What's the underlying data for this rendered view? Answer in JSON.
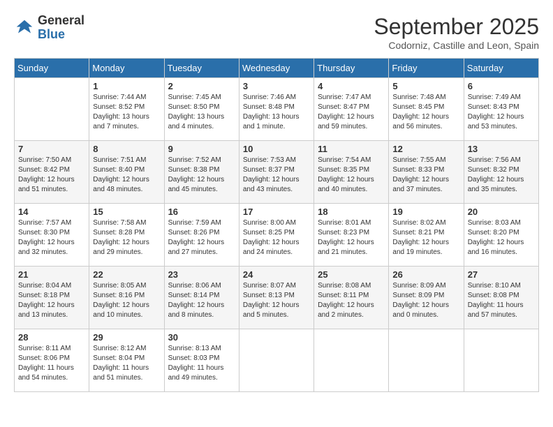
{
  "header": {
    "logo_line1": "General",
    "logo_line2": "Blue",
    "month": "September 2025",
    "location": "Codorniz, Castille and Leon, Spain"
  },
  "weekdays": [
    "Sunday",
    "Monday",
    "Tuesday",
    "Wednesday",
    "Thursday",
    "Friday",
    "Saturday"
  ],
  "weeks": [
    [
      {
        "day": "",
        "sunrise": "",
        "sunset": "",
        "daylight": ""
      },
      {
        "day": "1",
        "sunrise": "Sunrise: 7:44 AM",
        "sunset": "Sunset: 8:52 PM",
        "daylight": "Daylight: 13 hours and 7 minutes."
      },
      {
        "day": "2",
        "sunrise": "Sunrise: 7:45 AM",
        "sunset": "Sunset: 8:50 PM",
        "daylight": "Daylight: 13 hours and 4 minutes."
      },
      {
        "day": "3",
        "sunrise": "Sunrise: 7:46 AM",
        "sunset": "Sunset: 8:48 PM",
        "daylight": "Daylight: 13 hours and 1 minute."
      },
      {
        "day": "4",
        "sunrise": "Sunrise: 7:47 AM",
        "sunset": "Sunset: 8:47 PM",
        "daylight": "Daylight: 12 hours and 59 minutes."
      },
      {
        "day": "5",
        "sunrise": "Sunrise: 7:48 AM",
        "sunset": "Sunset: 8:45 PM",
        "daylight": "Daylight: 12 hours and 56 minutes."
      },
      {
        "day": "6",
        "sunrise": "Sunrise: 7:49 AM",
        "sunset": "Sunset: 8:43 PM",
        "daylight": "Daylight: 12 hours and 53 minutes."
      }
    ],
    [
      {
        "day": "7",
        "sunrise": "Sunrise: 7:50 AM",
        "sunset": "Sunset: 8:42 PM",
        "daylight": "Daylight: 12 hours and 51 minutes."
      },
      {
        "day": "8",
        "sunrise": "Sunrise: 7:51 AM",
        "sunset": "Sunset: 8:40 PM",
        "daylight": "Daylight: 12 hours and 48 minutes."
      },
      {
        "day": "9",
        "sunrise": "Sunrise: 7:52 AM",
        "sunset": "Sunset: 8:38 PM",
        "daylight": "Daylight: 12 hours and 45 minutes."
      },
      {
        "day": "10",
        "sunrise": "Sunrise: 7:53 AM",
        "sunset": "Sunset: 8:37 PM",
        "daylight": "Daylight: 12 hours and 43 minutes."
      },
      {
        "day": "11",
        "sunrise": "Sunrise: 7:54 AM",
        "sunset": "Sunset: 8:35 PM",
        "daylight": "Daylight: 12 hours and 40 minutes."
      },
      {
        "day": "12",
        "sunrise": "Sunrise: 7:55 AM",
        "sunset": "Sunset: 8:33 PM",
        "daylight": "Daylight: 12 hours and 37 minutes."
      },
      {
        "day": "13",
        "sunrise": "Sunrise: 7:56 AM",
        "sunset": "Sunset: 8:32 PM",
        "daylight": "Daylight: 12 hours and 35 minutes."
      }
    ],
    [
      {
        "day": "14",
        "sunrise": "Sunrise: 7:57 AM",
        "sunset": "Sunset: 8:30 PM",
        "daylight": "Daylight: 12 hours and 32 minutes."
      },
      {
        "day": "15",
        "sunrise": "Sunrise: 7:58 AM",
        "sunset": "Sunset: 8:28 PM",
        "daylight": "Daylight: 12 hours and 29 minutes."
      },
      {
        "day": "16",
        "sunrise": "Sunrise: 7:59 AM",
        "sunset": "Sunset: 8:26 PM",
        "daylight": "Daylight: 12 hours and 27 minutes."
      },
      {
        "day": "17",
        "sunrise": "Sunrise: 8:00 AM",
        "sunset": "Sunset: 8:25 PM",
        "daylight": "Daylight: 12 hours and 24 minutes."
      },
      {
        "day": "18",
        "sunrise": "Sunrise: 8:01 AM",
        "sunset": "Sunset: 8:23 PM",
        "daylight": "Daylight: 12 hours and 21 minutes."
      },
      {
        "day": "19",
        "sunrise": "Sunrise: 8:02 AM",
        "sunset": "Sunset: 8:21 PM",
        "daylight": "Daylight: 12 hours and 19 minutes."
      },
      {
        "day": "20",
        "sunrise": "Sunrise: 8:03 AM",
        "sunset": "Sunset: 8:20 PM",
        "daylight": "Daylight: 12 hours and 16 minutes."
      }
    ],
    [
      {
        "day": "21",
        "sunrise": "Sunrise: 8:04 AM",
        "sunset": "Sunset: 8:18 PM",
        "daylight": "Daylight: 12 hours and 13 minutes."
      },
      {
        "day": "22",
        "sunrise": "Sunrise: 8:05 AM",
        "sunset": "Sunset: 8:16 PM",
        "daylight": "Daylight: 12 hours and 10 minutes."
      },
      {
        "day": "23",
        "sunrise": "Sunrise: 8:06 AM",
        "sunset": "Sunset: 8:14 PM",
        "daylight": "Daylight: 12 hours and 8 minutes."
      },
      {
        "day": "24",
        "sunrise": "Sunrise: 8:07 AM",
        "sunset": "Sunset: 8:13 PM",
        "daylight": "Daylight: 12 hours and 5 minutes."
      },
      {
        "day": "25",
        "sunrise": "Sunrise: 8:08 AM",
        "sunset": "Sunset: 8:11 PM",
        "daylight": "Daylight: 12 hours and 2 minutes."
      },
      {
        "day": "26",
        "sunrise": "Sunrise: 8:09 AM",
        "sunset": "Sunset: 8:09 PM",
        "daylight": "Daylight: 12 hours and 0 minutes."
      },
      {
        "day": "27",
        "sunrise": "Sunrise: 8:10 AM",
        "sunset": "Sunset: 8:08 PM",
        "daylight": "Daylight: 11 hours and 57 minutes."
      }
    ],
    [
      {
        "day": "28",
        "sunrise": "Sunrise: 8:11 AM",
        "sunset": "Sunset: 8:06 PM",
        "daylight": "Daylight: 11 hours and 54 minutes."
      },
      {
        "day": "29",
        "sunrise": "Sunrise: 8:12 AM",
        "sunset": "Sunset: 8:04 PM",
        "daylight": "Daylight: 11 hours and 51 minutes."
      },
      {
        "day": "30",
        "sunrise": "Sunrise: 8:13 AM",
        "sunset": "Sunset: 8:03 PM",
        "daylight": "Daylight: 11 hours and 49 minutes."
      },
      {
        "day": "",
        "sunrise": "",
        "sunset": "",
        "daylight": ""
      },
      {
        "day": "",
        "sunrise": "",
        "sunset": "",
        "daylight": ""
      },
      {
        "day": "",
        "sunrise": "",
        "sunset": "",
        "daylight": ""
      },
      {
        "day": "",
        "sunrise": "",
        "sunset": "",
        "daylight": ""
      }
    ]
  ]
}
